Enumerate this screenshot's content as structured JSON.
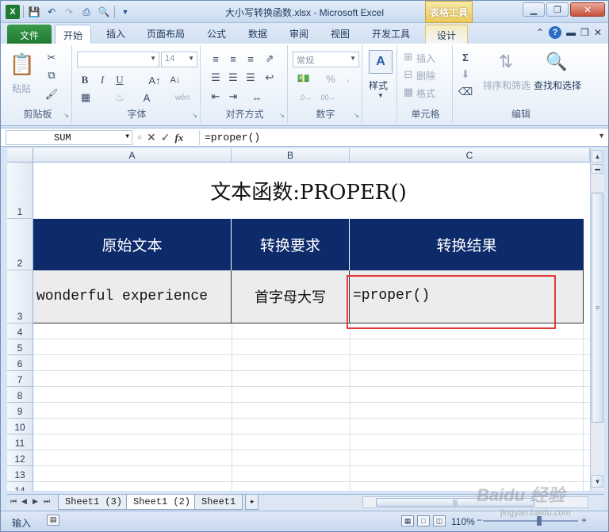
{
  "window": {
    "title": "大小写转换函数.xlsx - Microsoft Excel",
    "context_tab": "表格工具",
    "minimize": "▁",
    "restore": "❐",
    "close": "✕"
  },
  "ribbon_tabs": {
    "file": "文件",
    "items": [
      "开始",
      "插入",
      "页面布局",
      "公式",
      "数据",
      "审阅",
      "视图",
      "开发工具"
    ],
    "design": "设计"
  },
  "ribbon": {
    "clipboard": {
      "label": "剪贴板",
      "paste": "粘贴"
    },
    "font": {
      "label": "字体",
      "font_name": "",
      "font_size": "14",
      "bold": "B",
      "italic": "I",
      "underline": "U",
      "wen": "wén"
    },
    "alignment": {
      "label": "对齐方式"
    },
    "number": {
      "label": "数字",
      "format": "常规",
      "percent": "%"
    },
    "styles": {
      "label": "样式"
    },
    "cells": {
      "label": "单元格",
      "insert": "插入",
      "delete": "删除",
      "format": "格式"
    },
    "editing": {
      "label": "编辑",
      "sort_filter": "排序和筛选",
      "find_select": "查找和选择"
    }
  },
  "formula_bar": {
    "name_box": "SUM",
    "fx": "fx",
    "formula": "=proper()"
  },
  "grid": {
    "columns": [
      "A",
      "B",
      "C"
    ],
    "rows": [
      "1",
      "2",
      "3",
      "4",
      "5",
      "6",
      "7",
      "8",
      "9",
      "10",
      "11",
      "12",
      "13",
      "14"
    ],
    "title": "文本函数:PROPER()",
    "headers": [
      "原始文本",
      "转换要求",
      "转换结果"
    ],
    "row3": [
      "wonderful experience",
      "首字母大写",
      "=proper()"
    ]
  },
  "sheets": {
    "tabs": [
      "Sheet1 (3)",
      "Sheet1 (2)",
      "Sheet1"
    ],
    "active_index": 1
  },
  "status": {
    "mode": "输入",
    "zoom": "110%"
  },
  "watermark": {
    "text": "Baidu 经验",
    "sub": "jingyan.baidu.com"
  },
  "colors": {
    "header_bg": "#0d2a6b",
    "data_bg": "#ececec",
    "highlight": "#e23b3b",
    "file_tab": "#2a8a3c"
  }
}
